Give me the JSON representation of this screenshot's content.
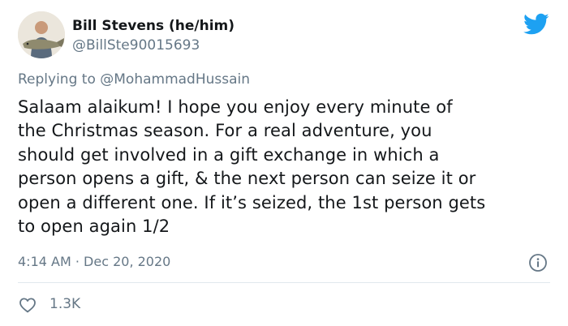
{
  "author": {
    "display_name": "Bill Stevens (he/him)",
    "handle": "@BillSte90015693",
    "avatar_icon": "profile-photo-person-with-fish"
  },
  "brand": {
    "logo_icon": "twitter-bird-icon",
    "accent_color": "#1da1f2"
  },
  "reply": {
    "prefix": "Replying to",
    "mention": "@MohammadHussain"
  },
  "tweet": {
    "lines": [
      "Salaam alaikum! I hope you enjoy every minute of",
      "the Christmas season. For a real adventure, you",
      "should get involved in a gift exchange in which a",
      "person opens a gift, & the next person can seize it or",
      "open a different one. If it’s seized, the 1st person gets",
      "to open again 1/2"
    ],
    "time": "4:14 AM",
    "separator": "·",
    "date": "Dec 20, 2020"
  },
  "engagement": {
    "likes": "1.3K"
  },
  "colors": {
    "text_primary": "#14171a",
    "text_secondary": "#657786",
    "divider": "#e1e8ed"
  }
}
